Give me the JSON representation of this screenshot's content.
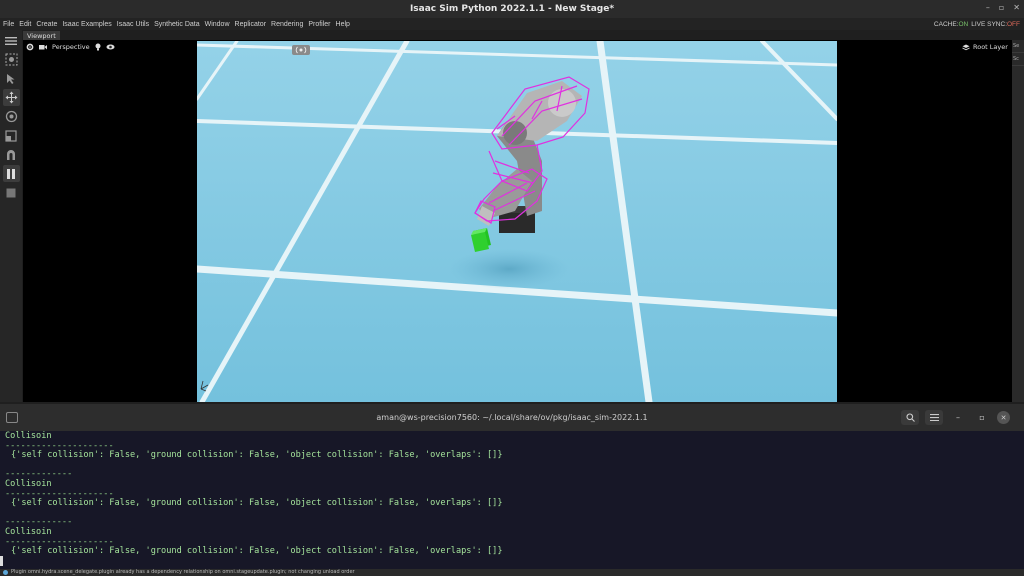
{
  "window": {
    "title": "Isaac Sim Python 2022.1.1 - New Stage*"
  },
  "menu": {
    "items": [
      "File",
      "Edit",
      "Create",
      "Isaac Examples",
      "Isaac Utils",
      "Synthetic Data",
      "Window",
      "Replicator",
      "Rendering",
      "Profiler",
      "Help"
    ],
    "cache_label": "CACHE:",
    "cache_value": "ON",
    "live_sync_label": "LIVE SYNC:",
    "live_sync_value": "OFF"
  },
  "viewport": {
    "tab_label": "Viewport",
    "camera_label": "Perspective",
    "root_layer_label": "Root Layer"
  },
  "right_strip": {
    "items": [
      "Se",
      "Sc"
    ]
  },
  "terminal": {
    "title": "aman@ws-precision7560: ~/.local/share/ov/pkg/isaac_sim-2022.1.1",
    "lines": [
      {
        "text": "Collisoin",
        "kind": "text"
      },
      {
        "text": "---------------------",
        "kind": "dim"
      },
      {
        "text": "{'self collision': False, 'ground collision': False, 'object collision': False, 'overlaps': []}",
        "kind": "dict"
      },
      {
        "text": "",
        "kind": "text"
      },
      {
        "text": "-------------",
        "kind": "dim"
      },
      {
        "text": "Collisoin",
        "kind": "text"
      },
      {
        "text": "---------------------",
        "kind": "dim"
      },
      {
        "text": "{'self collision': False, 'ground collision': False, 'object collision': False, 'overlaps': []}",
        "kind": "dict"
      },
      {
        "text": "",
        "kind": "text"
      },
      {
        "text": "-------------",
        "kind": "dim"
      },
      {
        "text": "Collisoin",
        "kind": "text"
      },
      {
        "text": "---------------------",
        "kind": "dim"
      },
      {
        "text": "{'self collision': False, 'ground collision': False, 'object collision': False, 'overlaps': []}",
        "kind": "dict"
      }
    ]
  },
  "status_bar": {
    "message": "Plugin omni.hydra.scene_delegate.plugin already has a dependency relationship on omni.stageupdate.plugin; not changing unload order"
  },
  "colors": {
    "sky": "#8fd0e8",
    "floor": "#7ec6e0",
    "grid_line": "#e8f4f8",
    "robot_outline": "#e030e0",
    "cube": "#2fd02f",
    "terminal_text": "#a4e39b"
  }
}
